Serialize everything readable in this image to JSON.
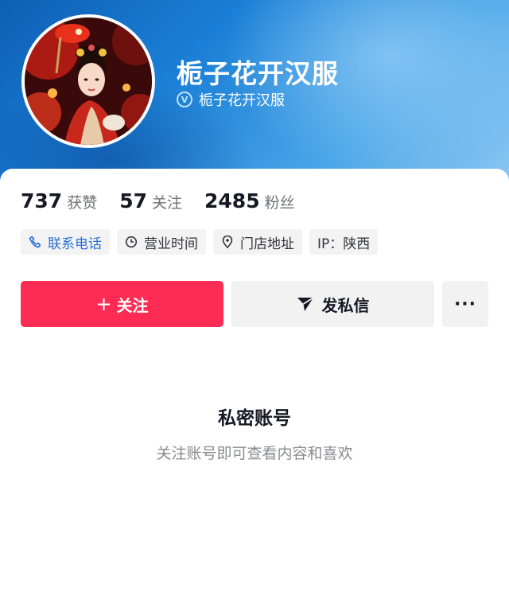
{
  "profile": {
    "display_name": "栀子花开汉服",
    "verified_label": "栀子花开汉服",
    "verified_badge": "V",
    "avatar_icon": "avatar-portrait-hanfu"
  },
  "stats": [
    {
      "value": "737",
      "label": "获赞"
    },
    {
      "value": "57",
      "label": "关注"
    },
    {
      "value": "2485",
      "label": "粉丝"
    }
  ],
  "tags": {
    "phone": {
      "label": "联系电话",
      "icon": "phone-icon"
    },
    "hours": {
      "label": "营业时间",
      "icon": "clock-icon"
    },
    "address": {
      "label": "门店地址",
      "icon": "location-pin-icon"
    },
    "ip": {
      "label": "IP：陕西"
    }
  },
  "actions": {
    "follow_label": "关注",
    "follow_icon": "+",
    "message_label": "发私信",
    "more_label": "···"
  },
  "private": {
    "title": "私密账号",
    "subtitle": "关注账号即可查看内容和喜欢"
  },
  "colors": {
    "accent": "#fe2c55",
    "link": "#2a6fd6",
    "header_top": "#0e5fb5",
    "header_bottom": "#8cc8f2"
  }
}
